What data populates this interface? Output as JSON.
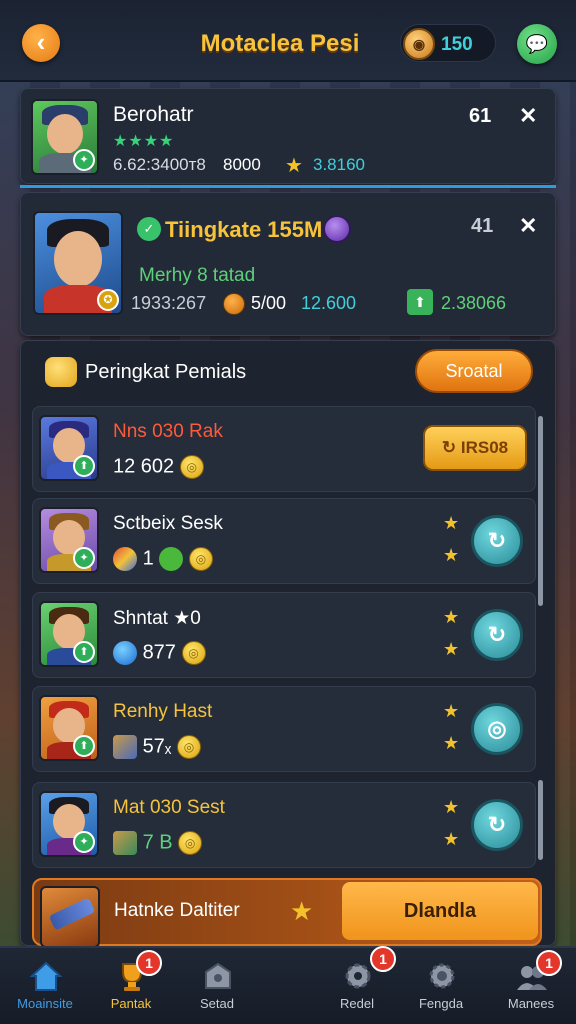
{
  "header": {
    "title": "Motaclea Pesi",
    "coin_value": "150"
  },
  "top_card": {
    "name": "Berohatr",
    "rating_stars": "★★★★",
    "stat_text": "6.62:3400ᴛ8",
    "score": "8000",
    "gold_value": "3.8160",
    "rank": "61"
  },
  "featured_card": {
    "title": "Tiingkate 155M",
    "subtitle": "Merhy 8 tatad",
    "stat_a": "1933:267",
    "stat_b": "5/00",
    "stat_c": "12.600",
    "stat_d": "2.38066",
    "rank": "41"
  },
  "leaderboard": {
    "heading": "Peringkat Pemials",
    "action_label": "Sroatal",
    "rows": [
      {
        "name": "Nns 030 Rak",
        "value": "12 602",
        "action_label": "IRS08",
        "highlight": true
      },
      {
        "name": "Sctbeix Sesk",
        "value": "1",
        "action_icon": "refresh-icon"
      },
      {
        "name": "Shntat ★0",
        "value": "877",
        "action_icon": "refresh-icon"
      },
      {
        "name": "Renhy Hast",
        "value": "57ₓ",
        "action_icon": "target-icon"
      },
      {
        "name": "Mat 030 Sest",
        "value": "7 B",
        "action_icon": "refresh-icon"
      }
    ],
    "footer_row": {
      "name": "Hatnke Daltiter",
      "action_label": "Dlandla"
    }
  },
  "bottom_nav": {
    "items": [
      {
        "label": "Moainsite",
        "badge": ""
      },
      {
        "label": "Pantak",
        "badge": "1"
      },
      {
        "label": "Setad",
        "badge": ""
      },
      {
        "label": "Redel",
        "badge": "1"
      },
      {
        "label": "Fengda",
        "badge": ""
      },
      {
        "label": "Manees",
        "badge": "1"
      }
    ]
  },
  "colors": {
    "accent_orange": "#f0941c",
    "accent_teal": "#3fd0d9",
    "gold": "#f6c33b",
    "highlight_blue": "#2e9be0"
  }
}
